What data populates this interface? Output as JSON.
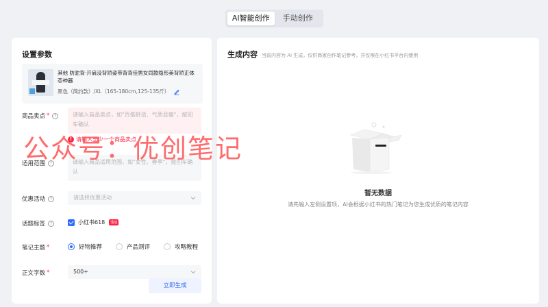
{
  "tabs": [
    {
      "label": "AI智能创作",
      "active": true
    },
    {
      "label": "手动创作",
      "active": false
    }
  ],
  "settings": {
    "title": "设置参数",
    "product": {
      "name": "其他 防驼背·开肩没背矫姿带背背佳男女同款隐形美背矫正体态神器",
      "sku": "黑色（简约款）/XL（165-180cm,125-135斤）"
    },
    "selling_points": {
      "label": "商品卖点",
      "placeholder": "请输入商品卖点，如\"百搭舒适、气质显瘦\"，按回车确认",
      "error": "请输入至少一个商品卖点"
    },
    "scope": {
      "label": "适用范围",
      "placeholder": "请输入商品适用范围，如\"女性、春季\"，按回车确认"
    },
    "promo": {
      "label": "优惠活动",
      "placeholder": "请选择优惠活动"
    },
    "topic": {
      "label": "话题标签",
      "tag": "小红书618",
      "badge": "活动"
    },
    "theme": {
      "label": "笔记主题",
      "options": [
        "好物推荐",
        "产品测评",
        "攻略教程"
      ],
      "selected": "好物推荐"
    },
    "wordcount": {
      "label": "正文字数",
      "value": "500+"
    },
    "generate_label": "立即生成"
  },
  "output": {
    "title": "生成内容",
    "subtitle": "当前内容为 AI 生成，仅供商家创作笔记参考，并仅限在小红书平台内使用",
    "empty_title": "暂无数据",
    "empty_desc": "请先输入左侧设置项，AI会根据小红书的热门笔记为您生成优质的笔记内容"
  },
  "watermark": "公众号：优创笔记",
  "colors": {
    "accent": "#2f6bff",
    "error": "#ff2442",
    "watermark": "#ff4d4f"
  }
}
